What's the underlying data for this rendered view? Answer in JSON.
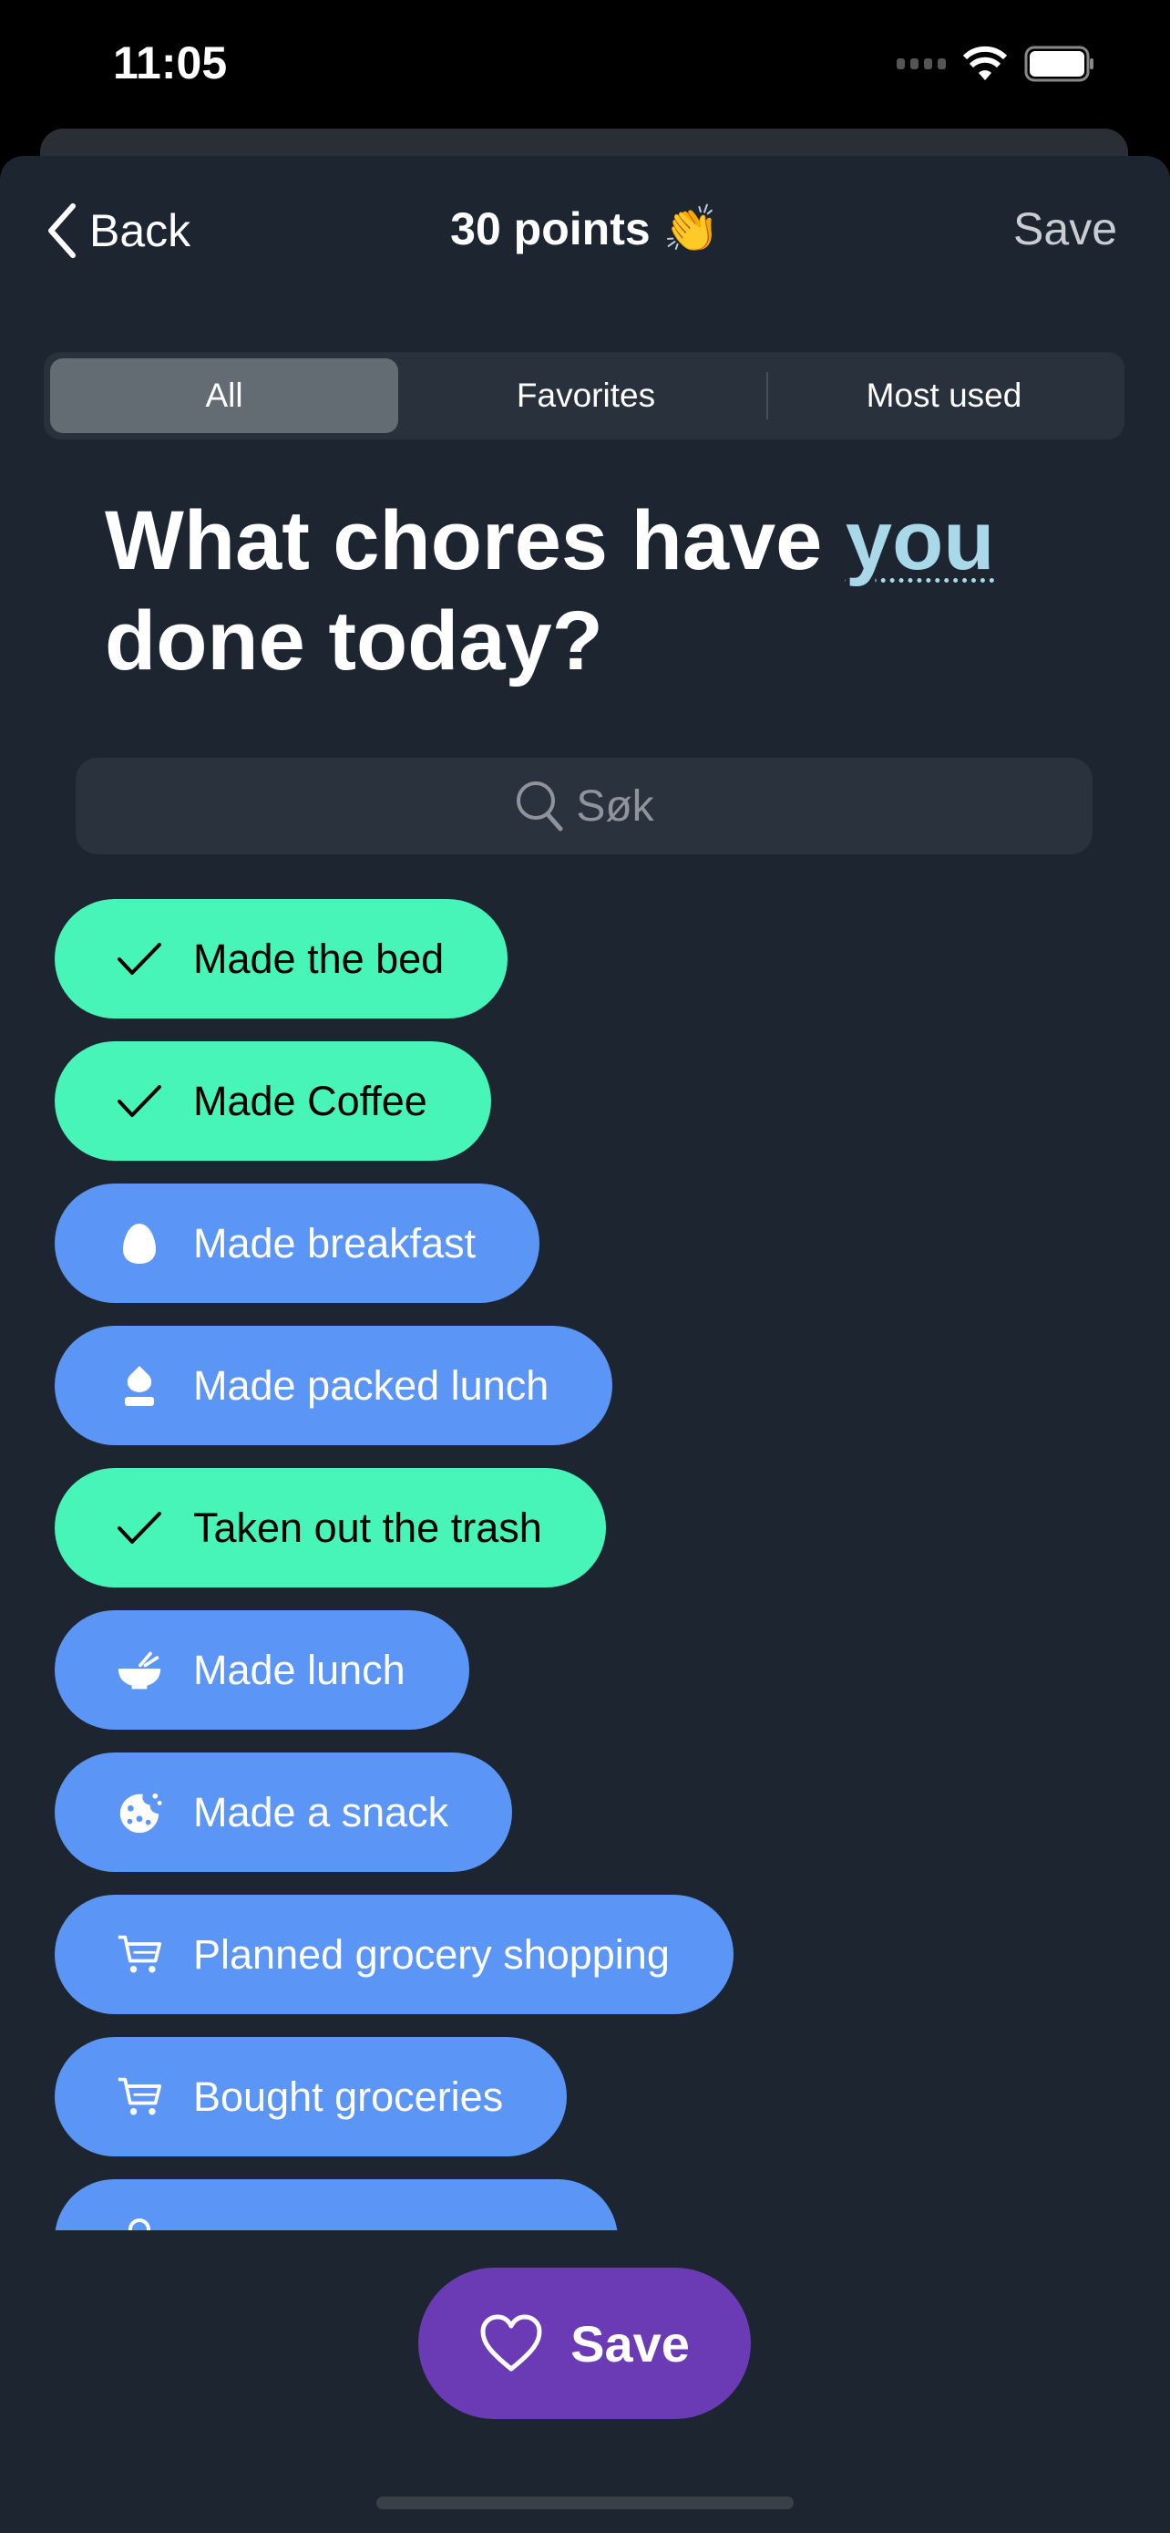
{
  "status_bar": {
    "time": "11:05"
  },
  "nav": {
    "back_label": "Back",
    "title": "30 points 👏",
    "save_label": "Save"
  },
  "segments": [
    {
      "label": "All",
      "selected": true
    },
    {
      "label": "Favorites",
      "selected": false
    },
    {
      "label": "Most used",
      "selected": false
    }
  ],
  "heading": {
    "prefix": "What chores have ",
    "highlight": "you",
    "suffix": " done today?"
  },
  "search": {
    "placeholder": "Søk"
  },
  "chores": [
    {
      "label": "Made the bed",
      "done": true,
      "icon": "checkmark-icon"
    },
    {
      "label": "Made Coffee",
      "done": true,
      "icon": "checkmark-icon"
    },
    {
      "label": "Made breakfast",
      "done": false,
      "icon": "egg-icon"
    },
    {
      "label": "Made packed lunch",
      "done": false,
      "icon": "packed-lunch-icon"
    },
    {
      "label": "Taken out the trash",
      "done": true,
      "icon": "checkmark-icon"
    },
    {
      "label": "Made lunch",
      "done": false,
      "icon": "bowl-icon"
    },
    {
      "label": "Made a snack",
      "done": false,
      "icon": "cookie-icon"
    },
    {
      "label": "Planned grocery shopping",
      "done": false,
      "icon": "cart-icon"
    },
    {
      "label": "Bought groceries",
      "done": false,
      "icon": "cart-icon"
    },
    {
      "label": "",
      "done": false,
      "icon": "bag-icon"
    }
  ],
  "save_button": {
    "label": "Save",
    "icon": "heart-icon"
  },
  "colors": {
    "done": "#47f5b8",
    "todo": "#5b95f5",
    "save": "#6a3bb5",
    "background": "#1c2530",
    "highlight": "#a9d8e8"
  }
}
